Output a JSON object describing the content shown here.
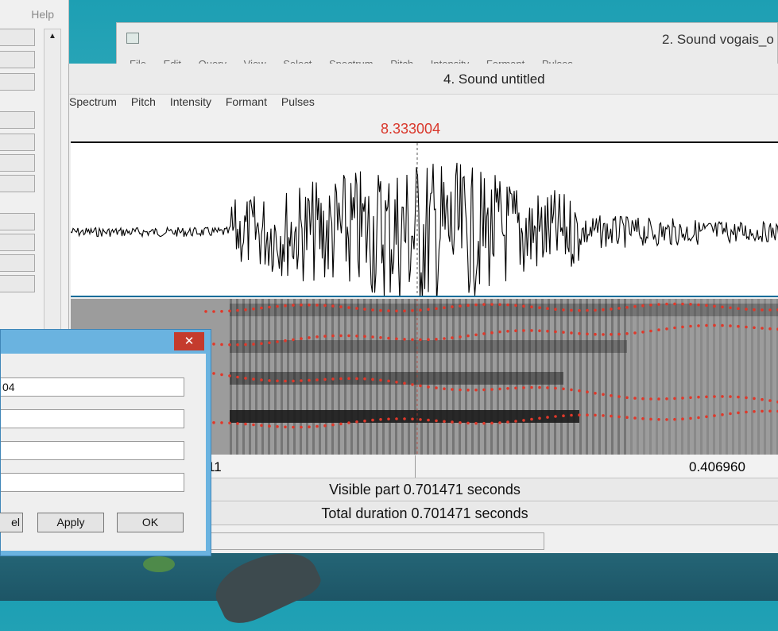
{
  "objects_window": {
    "menu_help": "Help",
    "scroll_up": "▲"
  },
  "sound_vogais_window": {
    "title": "2. Sound vogais_o",
    "menu": [
      "File",
      "Edit",
      "Query",
      "View",
      "Select",
      "Spectrum",
      "Pitch",
      "Intensity",
      "Formant",
      "Pulses"
    ]
  },
  "sound_untitled_window": {
    "title": "4. Sound untitled",
    "menu": [
      "Spectrum",
      "Pitch",
      "Intensity",
      "Formant",
      "Pulses"
    ],
    "cursor_value": "8.333004",
    "time_left": "11",
    "time_right": "0.406960",
    "visible_part": "Visible part 0.701471 seconds",
    "total_duration": "Total duration 0.701471 seconds"
  },
  "dialog": {
    "close_label": "✕",
    "fields": [
      "04",
      "",
      "",
      ""
    ],
    "buttons": {
      "cancel": "el",
      "apply": "Apply",
      "ok": "OK"
    }
  },
  "colors": {
    "cursor_red": "#d9372b",
    "formant_red": "#e0382a",
    "dialog_frame": "#6ab3e0"
  }
}
